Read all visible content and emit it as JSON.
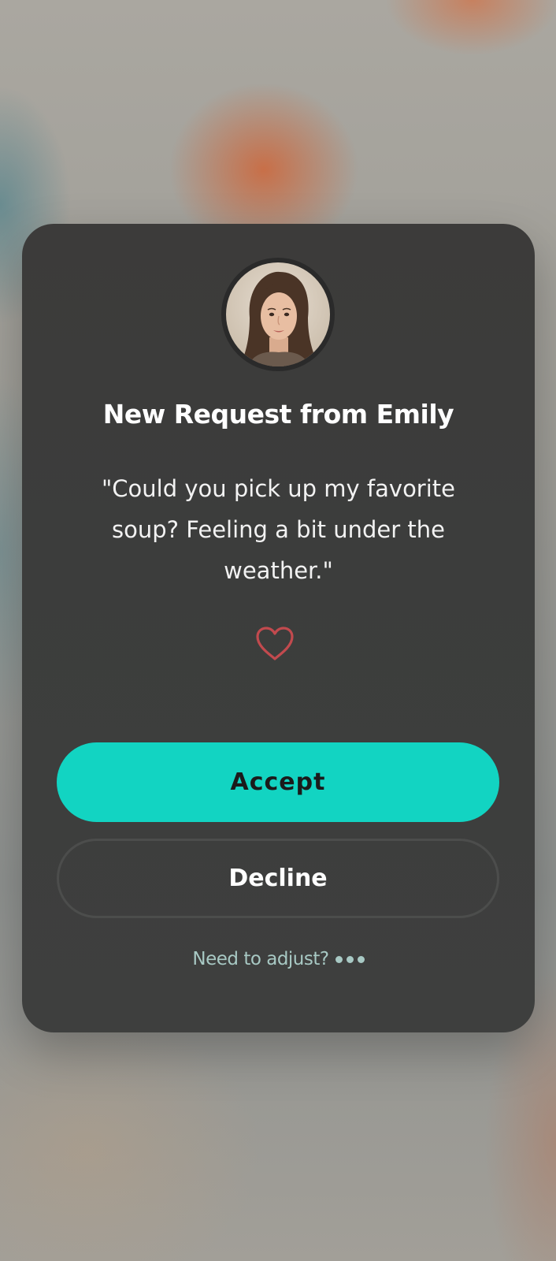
{
  "request": {
    "title": "New Request from Emily",
    "message": "\"Could you pick up my favorite soup? Feeling a bit under the weather.\"",
    "accept_label": "Accept",
    "decline_label": "Decline",
    "adjust_label": "Need to adjust?"
  },
  "icons": {
    "heart": "heart-icon",
    "more": "more-dots-icon"
  },
  "colors": {
    "accent": "#12d4c2",
    "heart": "#c24a4e",
    "card": "#3c3d3c",
    "adjust_text": "#a8c9c4"
  }
}
